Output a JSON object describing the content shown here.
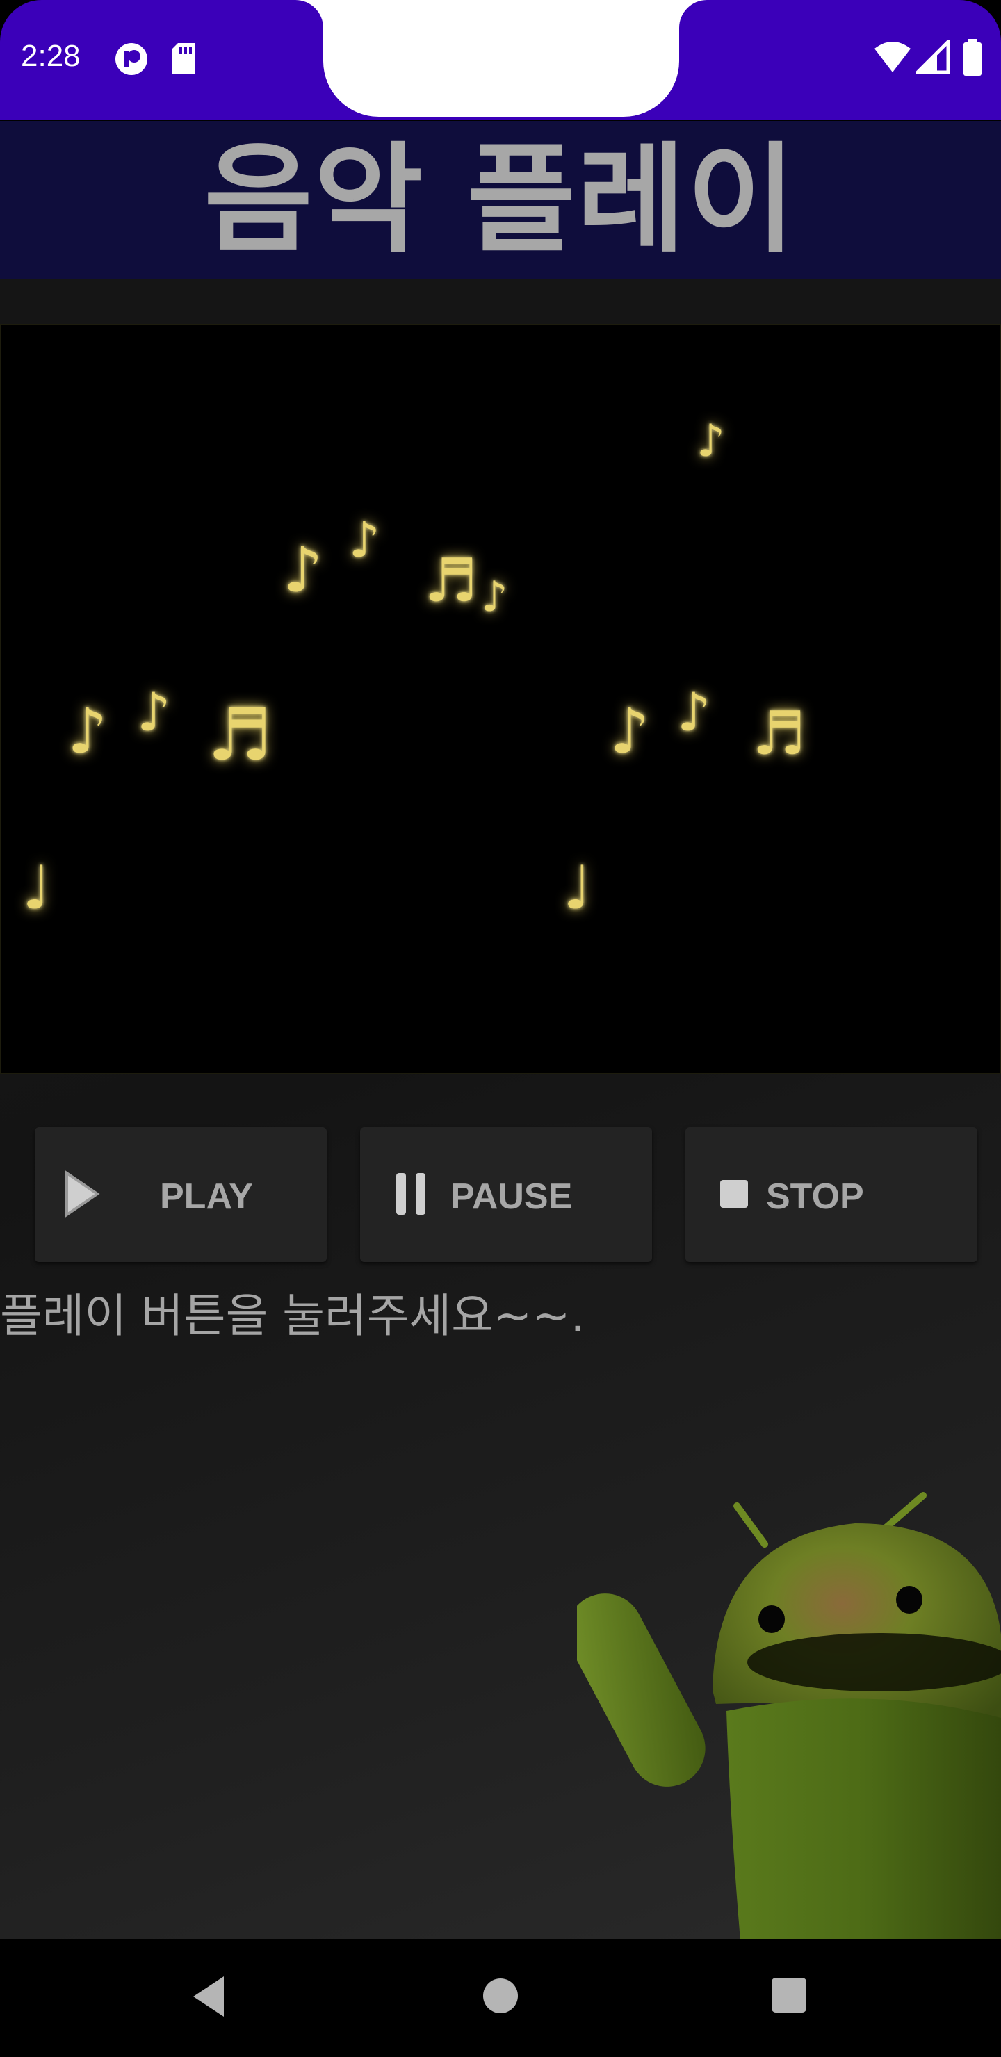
{
  "status_bar": {
    "time": "2:28",
    "icons": [
      "app-notification-icon",
      "sd-card-icon",
      "wifi-icon",
      "signal-icon",
      "battery-icon"
    ]
  },
  "app": {
    "title": "음악 플레이",
    "colors": {
      "status_bar": "#3b00b9",
      "title_bar": "#0f0d3c",
      "title_text": "#a7a7a7",
      "button_bg": "#232323",
      "note_color": "#e8d46f"
    }
  },
  "video": {
    "notes": [
      "eighth-note",
      "eighth-note",
      "eighth-note",
      "beamed-notes",
      "eighth-note",
      "eighth-note",
      "eighth-note",
      "beamed-notes",
      "eighth-note",
      "eighth-note",
      "beamed-notes",
      "quarter-note",
      "quarter-note"
    ]
  },
  "controls": {
    "play_label": "PLAY",
    "pause_label": "PAUSE",
    "stop_label": "STOP"
  },
  "status_message": "플레이 버튼을 눌러주세요~~.",
  "nav": {
    "back": "back-icon",
    "home": "home-icon",
    "recents": "recents-icon"
  }
}
